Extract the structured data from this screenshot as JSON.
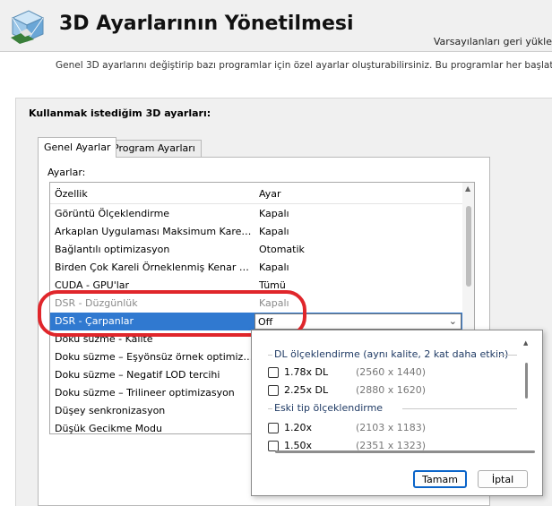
{
  "header": {
    "title": "3D Ayarlarının Yönetilmesi",
    "restore_link": "Varsayılanları geri yükle"
  },
  "description": "Genel 3D ayarlarını değiştirip bazı programlar için özel ayarlar oluşturabilirsiniz. Bu programlar her başlatılınca bu özel ayarlar kullanılacaktır.",
  "panel": {
    "title": "Kullanmak istediğim 3D ayarları:",
    "tabs": [
      {
        "label": "Genel Ayarlar"
      },
      {
        "label": "Program Ayarları"
      }
    ],
    "settings_label": "Ayarlar:"
  },
  "list": {
    "col_feature": "Özellik",
    "col_setting": "Ayar",
    "rows": [
      {
        "name": "Görüntü Ölçeklendirme",
        "value": "Kapalı"
      },
      {
        "name": "Arkaplan Uygulaması Maksimum Kare Hızı",
        "value": "Kapalı"
      },
      {
        "name": "Bağlantılı optimizasyon",
        "value": "Otomatik"
      },
      {
        "name": "Birden Çok Kareli Örneklenmiş Kenar Yumuşatma (MFAA)",
        "value": "Kapalı"
      },
      {
        "name": "CUDA - GPU'lar",
        "value": "Tümü"
      },
      {
        "name": "DSR - Düzgünlük",
        "value": "Kapalı"
      },
      {
        "name": "DSR - Çarpanlar",
        "value": "Off"
      },
      {
        "name": "Doku süzme - Kalite",
        "value": ""
      },
      {
        "name": "Doku süzme – Eşyönsüz örnek optimizasyonu",
        "value": ""
      },
      {
        "name": "Doku süzme – Negatif LOD tercihi",
        "value": ""
      },
      {
        "name": "Doku süzme – Trilineer optimizasyon",
        "value": ""
      },
      {
        "name": "Düşey senkronizasyon",
        "value": ""
      },
      {
        "name": "Düşük Gecikme Modu",
        "value": ""
      }
    ]
  },
  "popup": {
    "group1_title": "DL ölçeklendirme (aynı kalite, 2 kat daha etkin)",
    "group1": [
      {
        "label": "1.78x DL",
        "res": "(2560 x 1440)"
      },
      {
        "label": "2.25x DL",
        "res": "(2880 x 1620)"
      }
    ],
    "group2_title": "Eski tip ölçeklendirme",
    "group2": [
      {
        "label": "1.20x",
        "res": "(2103 x 1183)"
      },
      {
        "label": "1.50x",
        "res": "(2351 x 1323)"
      }
    ],
    "ok_label": "Tamam",
    "cancel_label": "İptal"
  },
  "colors": {
    "selection": "#3079d0",
    "highlight_ring": "#e0262b",
    "ok_border": "#0a64c9"
  },
  "icons": {
    "logo": "3d-cube-logo-icon",
    "dropdown": "chevron-down-icon"
  }
}
